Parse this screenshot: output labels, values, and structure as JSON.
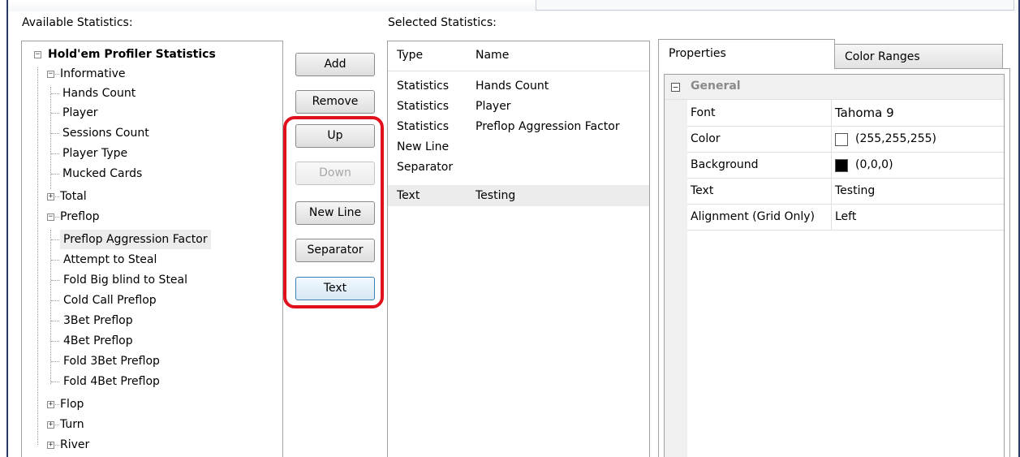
{
  "labels": {
    "available": "Available Statistics:",
    "selected": "Selected Statistics:"
  },
  "tree": {
    "root": "Hold'em Profiler Statistics",
    "informative": "Informative",
    "informative_items": [
      "Hands Count",
      "Player",
      "Sessions Count",
      "Player Type",
      "Mucked Cards"
    ],
    "total": "Total",
    "preflop": "Preflop",
    "preflop_items": [
      "Preflop Aggression Factor",
      "Attempt to Steal",
      "Fold Big blind to Steal",
      "Cold Call Preflop",
      "3Bet Preflop",
      "4Bet Preflop",
      "Fold 3Bet Preflop",
      "Fold 4Bet Preflop"
    ],
    "flop": "Flop",
    "turn": "Turn",
    "river": "River",
    "expand_sign": "+",
    "collapse_sign": "−"
  },
  "buttons": {
    "add": "Add",
    "remove": "Remove",
    "up": "Up",
    "down": "Down",
    "new_line": "New Line",
    "separator": "Separator",
    "text": "Text"
  },
  "selected_list": {
    "headers": {
      "type": "Type",
      "name": "Name"
    },
    "rows": [
      {
        "type": "Statistics",
        "name": "Hands Count"
      },
      {
        "type": "Statistics",
        "name": "Player"
      },
      {
        "type": "Statistics",
        "name": "Preflop Aggression Factor"
      },
      {
        "type": "New Line",
        "name": ""
      },
      {
        "type": "Separator",
        "name": ""
      },
      {
        "type": "Text",
        "name": "Testing"
      }
    ]
  },
  "tabs": {
    "properties": "Properties",
    "color_ranges": "Color Ranges"
  },
  "properties": {
    "category": "General",
    "collapse_sign": "−",
    "rows": [
      {
        "name": "Font",
        "value": "Tahoma 9"
      },
      {
        "name": "Color",
        "value": "(255,255,255)",
        "swatch": "#ffffff"
      },
      {
        "name": "Background",
        "value": "(0,0,0)",
        "swatch": "#000000"
      },
      {
        "name": "Text",
        "value": "Testing"
      },
      {
        "name": "Alignment (Grid Only)",
        "value": "Left"
      }
    ]
  },
  "colors": {
    "highlight": "#e0101c",
    "frame": "#2a3a6a",
    "selection": "#ececec"
  }
}
